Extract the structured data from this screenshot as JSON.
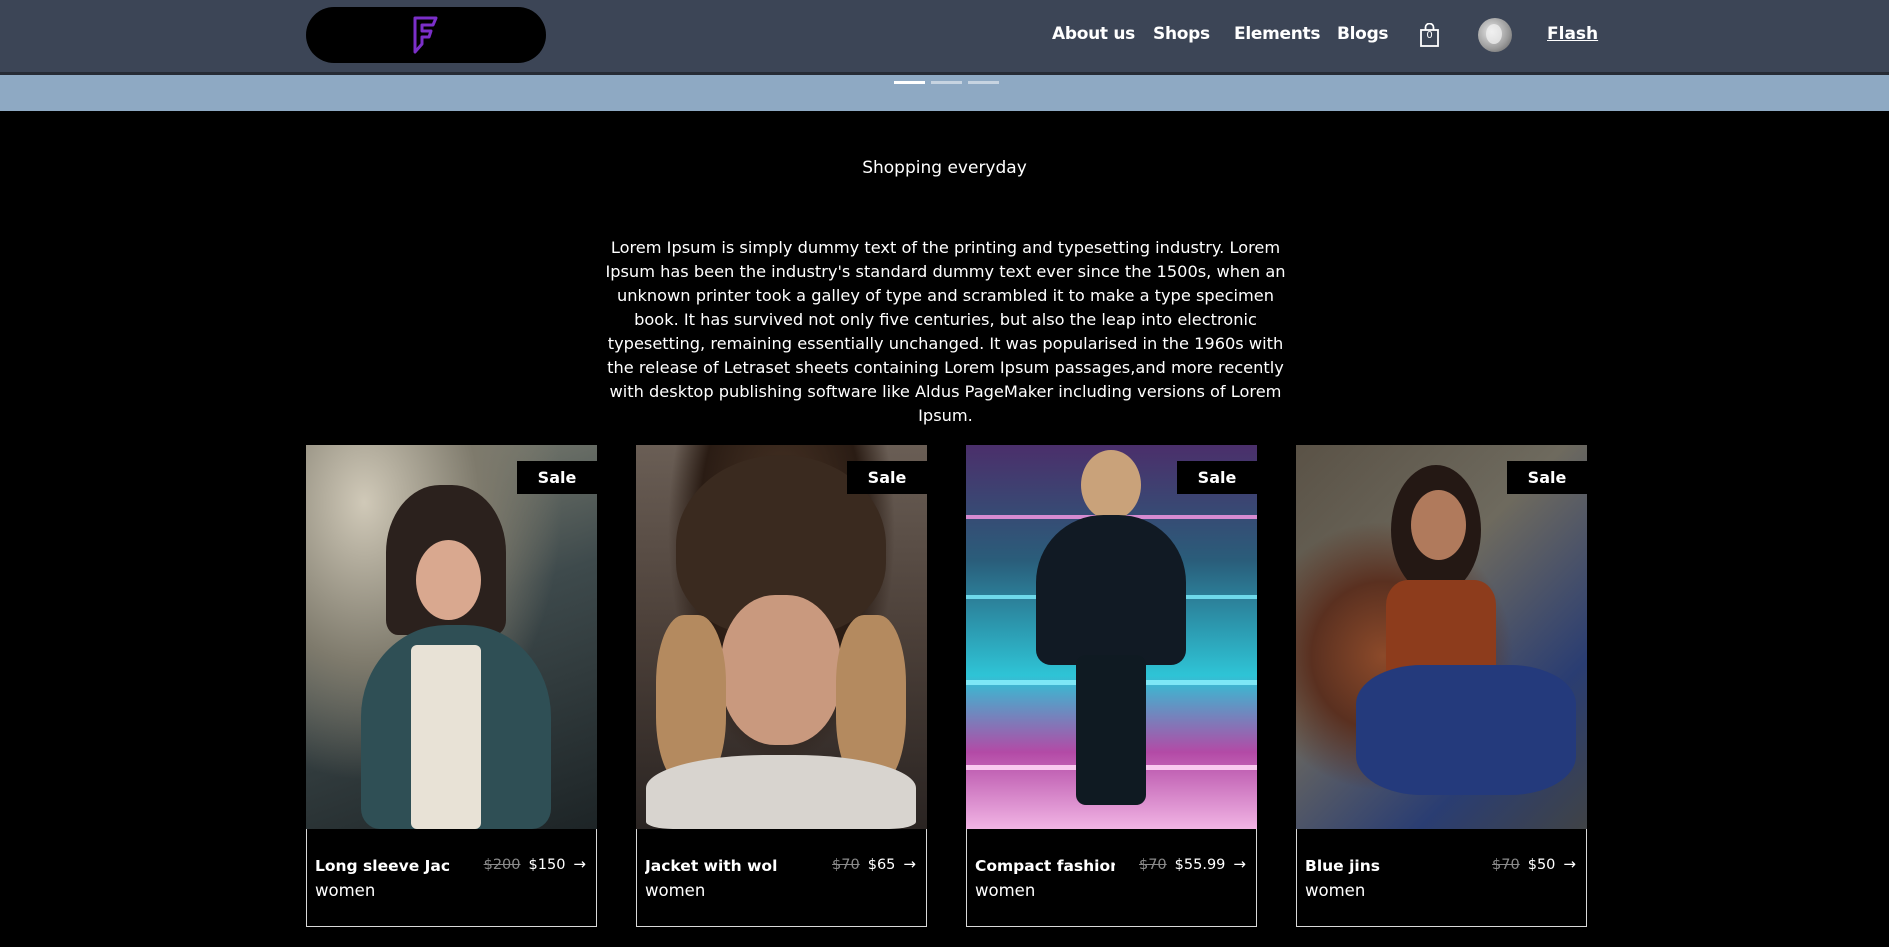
{
  "header": {
    "nav": [
      "About us",
      "Shops",
      "Elements",
      "Blogs"
    ],
    "cart_count": "0",
    "user_link": "Flash",
    "colors": {
      "bar": "#3c4556",
      "logo_accent": "#7b2fc9"
    }
  },
  "hero": {
    "slides": 3,
    "active_slide": 1,
    "strip_color": "#8ea9c3"
  },
  "section": {
    "subtitle": "Shopping everyday",
    "intro": "Lorem Ipsum is simply dummy text of the printing and typesetting industry. Lorem Ipsum has been the industry's standard dummy text ever since the 1500s, when an unknown printer took a galley of type and scrambled it to make a type specimen book. It has survived not only five centuries, but also the leap into electronic typesetting, remaining essentially unchanged. It was popularised in the 1960s with the release of Letraset sheets containing Lorem Ipsum passages,and more recently with desktop publishing software like Aldus PageMaker including versions of Lorem Ipsum."
  },
  "products": [
    {
      "badge": "Sale",
      "name": "Long sleeve Jac",
      "category": "women",
      "old_price": "$200",
      "price": "$150",
      "arrow": "→"
    },
    {
      "badge": "Sale",
      "name": "Jacket with wol",
      "category": "women",
      "old_price": "$70",
      "price": "$65",
      "arrow": "→"
    },
    {
      "badge": "Sale",
      "name": "Compact fashion",
      "category": "women",
      "old_price": "$70",
      "price": "$55.99",
      "arrow": "→"
    },
    {
      "badge": "Sale",
      "name": "Blue jins",
      "category": "women",
      "old_price": "$70",
      "price": "$50",
      "arrow": "→"
    }
  ]
}
